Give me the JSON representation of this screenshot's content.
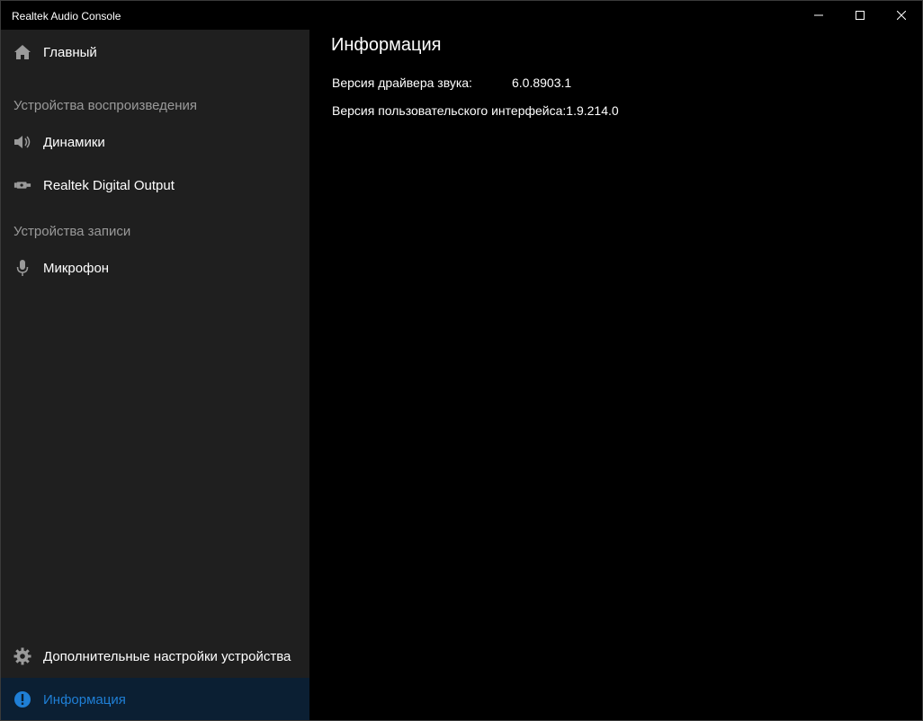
{
  "window": {
    "title": "Realtek Audio Console"
  },
  "sidebar": {
    "home": {
      "label": "Главный",
      "icon": "home-icon"
    },
    "playback_header": "Устройства воспроизведения",
    "playback_items": [
      {
        "label": "Динамики",
        "icon": "speaker-icon"
      },
      {
        "label": "Realtek Digital Output",
        "icon": "digital-output-icon"
      }
    ],
    "recording_header": "Устройства записи",
    "recording_items": [
      {
        "label": "Микрофон",
        "icon": "microphone-icon"
      }
    ],
    "advanced": {
      "label": "Дополнительные настройки устройства",
      "icon": "gear-icon"
    },
    "info": {
      "label": "Информация",
      "icon": "info-icon",
      "active": true
    }
  },
  "main": {
    "title": "Информация",
    "rows": [
      {
        "key": "Версия драйвера звука:",
        "value": "6.0.8903.1"
      },
      {
        "key": "Версия пользовательского интерфейса:",
        "value": "1.9.214.0"
      }
    ]
  },
  "colors": {
    "accent": "#1f7fd6",
    "sidebar_bg": "#1f1f1f",
    "active_bg": "#0b1f33",
    "content_bg": "#000000",
    "section_header": "#9a9a9a"
  }
}
